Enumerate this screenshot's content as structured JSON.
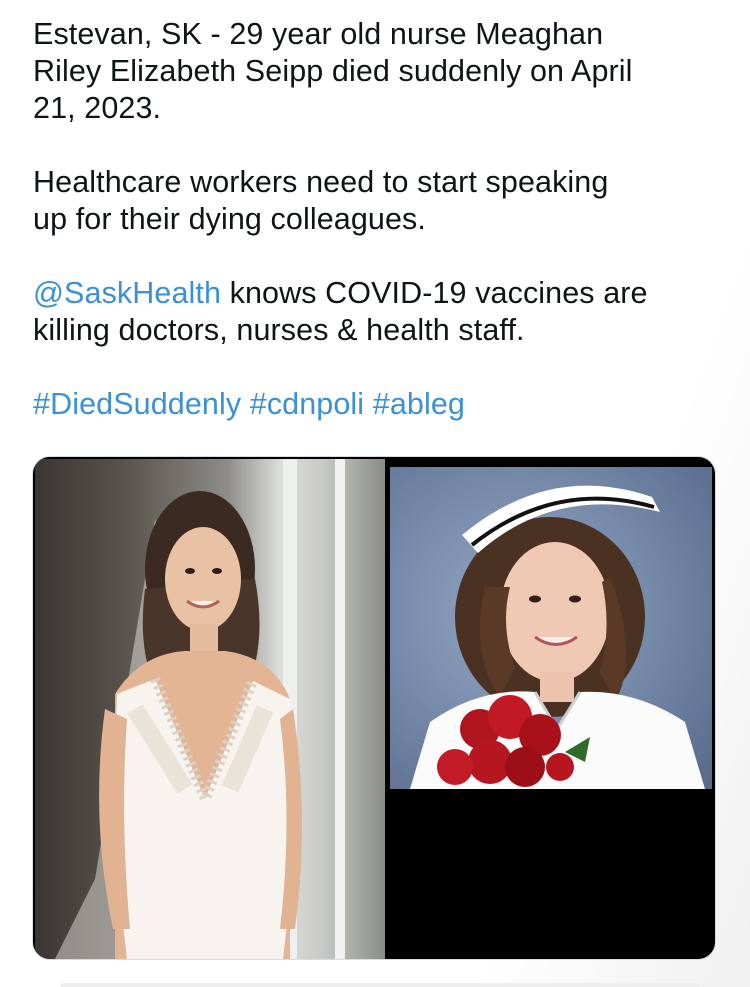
{
  "tweet": {
    "line1": "Estevan, SK - 29 year old nurse Meaghan\nRiley Elizabeth Seipp died suddenly on April\n21, 2023.",
    "line2": "Healthcare workers need to start speaking\nup for their dying colleagues.",
    "mention": "@SaskHealth",
    "line3_rest": " knows COVID-19 vaccines are\nkilling doctors, nurses & health staff.",
    "hashtags": [
      "#DiedSuddenly",
      "#cdnpoli",
      "#ableg"
    ]
  },
  "colors": {
    "link": "#3b91d9",
    "text": "#0f1419"
  }
}
